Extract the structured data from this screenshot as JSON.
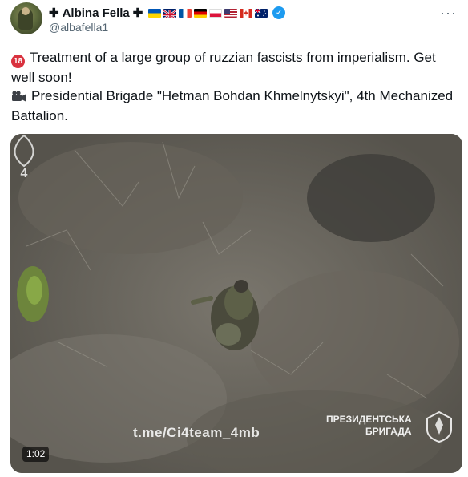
{
  "author": {
    "cross_left": "✚",
    "display_name": "Albina Fella",
    "cross_right": "✚",
    "handle": "@albafella1",
    "flags": [
      "ua",
      "gb",
      "fr",
      "de",
      "pl",
      "us",
      "ca",
      "au"
    ],
    "verified_icon": "verified-badge-icon",
    "verified_color": "#1d9bf0"
  },
  "menu": {
    "more_label": "···"
  },
  "tweet": {
    "line1": "Treatment of a large group of ruzzian fascists from imperialism. Get well soon!",
    "line2": "Presidential Brigade \"Hetman Bohdan Khmelnytskyi\", 4th Mechanized Battalion.",
    "badge_18": "18",
    "camera_icon": "video-camera-icon"
  },
  "media": {
    "watermark_url": "t.me/Ci4team_4mb",
    "watermark_brigade_line1": "ПРЕЗИДЕНТСЬКА",
    "watermark_brigade_line2": "БРИГАДА",
    "duration": "1:02"
  }
}
